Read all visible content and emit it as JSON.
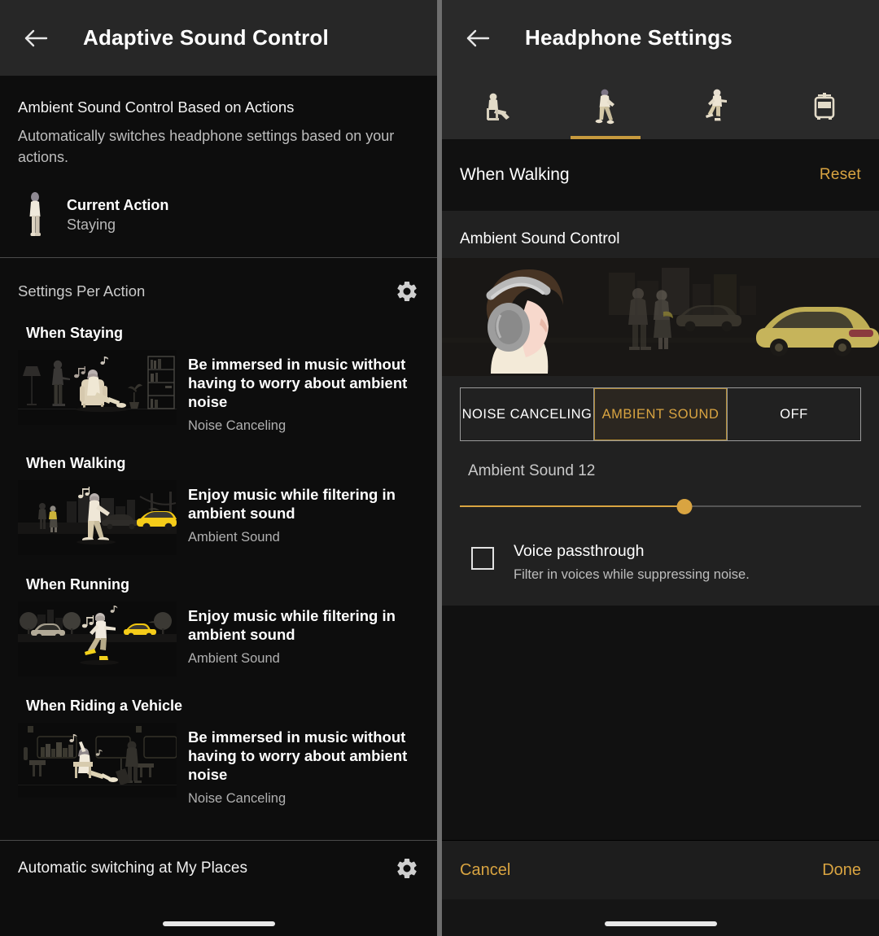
{
  "left": {
    "appbar": {
      "back_icon": "back-arrow-icon",
      "title": "Adaptive Sound Control"
    },
    "intro": {
      "title": "Ambient Sound Control Based on Actions",
      "subtitle": "Automatically switches headphone settings based on your actions."
    },
    "current_action": {
      "icon": "standing-person-icon",
      "label": "Current Action",
      "value": "Staying"
    },
    "per_action": {
      "title": "Settings Per Action",
      "gear_icon": "gear-icon"
    },
    "actions": [
      {
        "name": "When Staying",
        "thumb_icon": "living-room-illustration",
        "description": "Be immersed in music without having to worry about ambient noise",
        "mode": "Noise Canceling"
      },
      {
        "name": "When Walking",
        "thumb_icon": "city-street-walking-illustration",
        "description": "Enjoy music while filtering in ambient sound",
        "mode": "Ambient Sound"
      },
      {
        "name": "When Running",
        "thumb_icon": "running-street-illustration",
        "description": "Enjoy music while filtering in ambient sound",
        "mode": "Ambient Sound"
      },
      {
        "name": "When Riding a Vehicle",
        "thumb_icon": "train-interior-illustration",
        "description": "Be immersed in music without having to worry about ambient noise",
        "mode": "Noise Canceling"
      }
    ],
    "bottom": {
      "label": "Automatic switching at My Places",
      "gear_icon": "gear-icon"
    }
  },
  "right": {
    "appbar": {
      "back_icon": "back-arrow-icon",
      "title": "Headphone Settings"
    },
    "tabs": [
      {
        "icon": "person-sitting-icon",
        "name": "staying",
        "active": false
      },
      {
        "icon": "person-walking-icon",
        "name": "walking",
        "active": true
      },
      {
        "icon": "person-running-icon",
        "name": "running",
        "active": false
      },
      {
        "icon": "tram-vehicle-icon",
        "name": "vehicle",
        "active": false
      }
    ],
    "when_bar": {
      "title": "When Walking",
      "reset_label": "Reset"
    },
    "ambient": {
      "card_title": "Ambient Sound Control",
      "hero_icon": "woman-headphones-city-illustration",
      "segments": [
        {
          "label": "NOISE CANCELING",
          "selected": false
        },
        {
          "label": "AMBIENT SOUND",
          "selected": true
        },
        {
          "label": "OFF",
          "selected": false
        }
      ],
      "slider_label": "Ambient Sound 12",
      "slider_value": 12,
      "slider_min": 0,
      "slider_max": 20,
      "slider_percent": 56,
      "voice_passthrough": {
        "title": "Voice passthrough",
        "subtitle": "Filter in voices while suppressing noise.",
        "checked": false
      }
    },
    "footer": {
      "cancel_label": "Cancel",
      "done_label": "Done"
    }
  },
  "colors": {
    "accent": "#d9a441",
    "accent_underline": "#c79a3e",
    "appbar_bg": "#272727",
    "card_bg": "#212121",
    "page_bg": "#111111"
  }
}
